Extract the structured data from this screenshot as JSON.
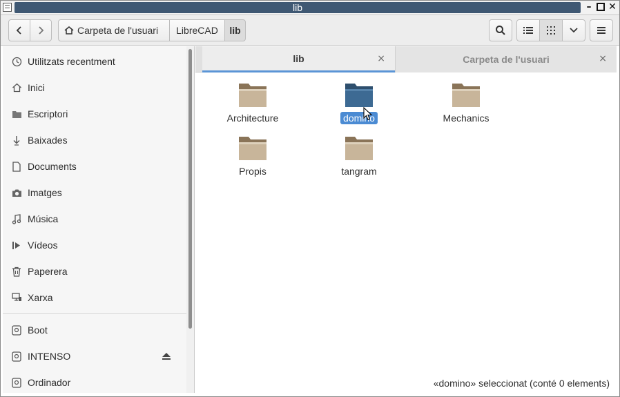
{
  "window": {
    "title": "lib"
  },
  "header": {
    "back_icon": "chevron-left-icon",
    "forward_icon": "chevron-right-icon",
    "breadcrumbs": [
      {
        "label": "Carpeta de l'usuari",
        "icon": "home-icon"
      },
      {
        "label": "LibreCAD"
      },
      {
        "label": "lib"
      }
    ],
    "search_icon": "search-icon",
    "list_view_icon": "list-view-icon",
    "grid_view_icon": "grid-view-icon",
    "view_options_icon": "chevron-down-icon",
    "menu_icon": "hamburger-menu-icon"
  },
  "sidebar": {
    "places": [
      {
        "label": "Utilitzats recentment",
        "icon": "clock-icon"
      },
      {
        "label": "Inici",
        "icon": "home-icon"
      },
      {
        "label": "Escriptori",
        "icon": "desktop-folder-icon"
      },
      {
        "label": "Baixades",
        "icon": "download-icon"
      },
      {
        "label": "Documents",
        "icon": "document-icon"
      },
      {
        "label": "Imatges",
        "icon": "camera-icon"
      },
      {
        "label": "Música",
        "icon": "music-icon"
      },
      {
        "label": "Vídeos",
        "icon": "video-icon"
      },
      {
        "label": "Paperera",
        "icon": "trash-icon"
      },
      {
        "label": "Xarxa",
        "icon": "network-icon"
      }
    ],
    "devices": [
      {
        "label": "Boot",
        "icon": "drive-icon"
      },
      {
        "label": "INTENSO",
        "icon": "drive-icon",
        "eject": true
      },
      {
        "label": "Ordinador",
        "icon": "drive-icon"
      }
    ]
  },
  "tabs": [
    {
      "label": "lib",
      "active": true
    },
    {
      "label": "Carpeta de l'usuari",
      "active": false
    }
  ],
  "items": [
    {
      "name": "Architecture",
      "selected": false
    },
    {
      "name": "domino",
      "selected": true
    },
    {
      "name": "Mechanics",
      "selected": false
    },
    {
      "name": "Propis",
      "selected": false
    },
    {
      "name": "tangram",
      "selected": false
    }
  ],
  "status": {
    "text": "«domino» seleccionat  (conté 0 elements)"
  },
  "colors": {
    "accent": "#4b8bd3",
    "title_bar": "#3f5873",
    "folder": "#c8b59a",
    "folder_selected": "#3d6a93"
  }
}
